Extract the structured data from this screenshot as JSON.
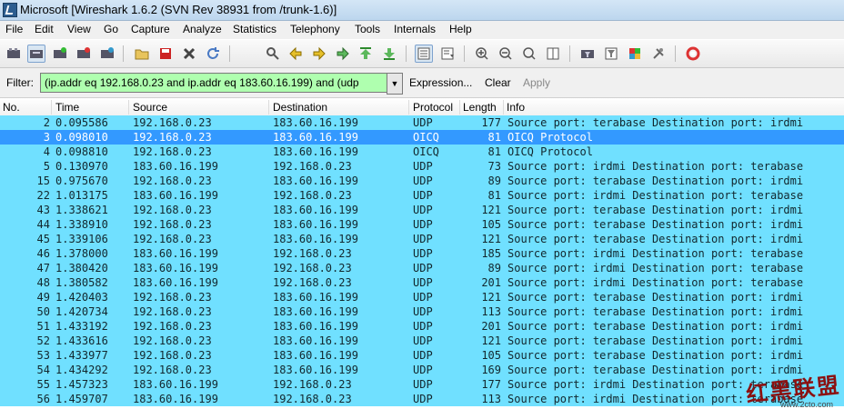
{
  "window": {
    "title": "Microsoft    [Wireshark 1.6.2  (SVN Rev 38931 from /trunk-1.6)]"
  },
  "menu": [
    "File",
    "Edit",
    "View",
    "Go",
    "Capture",
    "Analyze",
    "Statistics",
    "Telephony",
    "Tools",
    "Internals",
    "Help"
  ],
  "toolbar": {
    "icons": [
      "interface-list-icon",
      "capture-options-icon",
      "start-capture-icon",
      "stop-capture-icon",
      "restart-capture-icon",
      "open-file-icon",
      "save-file-icon",
      "close-file-icon",
      "reload-icon",
      "find-packet-icon",
      "go-back-icon",
      "go-forward-icon",
      "go-to-packet-icon",
      "go-first-icon",
      "go-last-icon",
      "colorize-icon",
      "autoscroll-icon",
      "zoom-in-icon",
      "zoom-out-icon",
      "zoom-normal-icon",
      "resize-columns-icon",
      "capture-filters-icon",
      "display-filters-icon",
      "coloring-rules-icon",
      "preferences-icon",
      "help-icon"
    ]
  },
  "filter": {
    "label": "Filter:",
    "value": "(ip.addr eq 192.168.0.23 and ip.addr eq 183.60.16.199) and (udp",
    "expression_label": "Expression...",
    "clear_label": "Clear",
    "apply_label": "Apply"
  },
  "columns": {
    "no": "No.",
    "time": "Time",
    "source": "Source",
    "destination": "Destination",
    "protocol": "Protocol",
    "length": "Length",
    "info": "Info"
  },
  "packets": [
    {
      "no": "2",
      "time": "0.095586",
      "src": "192.168.0.23",
      "dst": "183.60.16.199",
      "proto": "UDP",
      "len": "177",
      "info": "Source port: terabase  Destination port: irdmi"
    },
    {
      "no": "3",
      "time": "0.098010",
      "src": "192.168.0.23",
      "dst": "183.60.16.199",
      "proto": "OICQ",
      "len": "81",
      "info": "OICQ Protocol"
    },
    {
      "no": "4",
      "time": "0.098810",
      "src": "192.168.0.23",
      "dst": "183.60.16.199",
      "proto": "OICQ",
      "len": "81",
      "info": "OICQ Protocol"
    },
    {
      "no": "5",
      "time": "0.130970",
      "src": "183.60.16.199",
      "dst": "192.168.0.23",
      "proto": "UDP",
      "len": "73",
      "info": "Source port: irdmi  Destination port: terabase"
    },
    {
      "no": "15",
      "time": "0.975670",
      "src": "192.168.0.23",
      "dst": "183.60.16.199",
      "proto": "UDP",
      "len": "89",
      "info": "Source port: terabase  Destination port: irdmi"
    },
    {
      "no": "22",
      "time": "1.013175",
      "src": "183.60.16.199",
      "dst": "192.168.0.23",
      "proto": "UDP",
      "len": "81",
      "info": "Source port: irdmi  Destination port: terabase"
    },
    {
      "no": "43",
      "time": "1.338621",
      "src": "192.168.0.23",
      "dst": "183.60.16.199",
      "proto": "UDP",
      "len": "121",
      "info": "Source port: terabase  Destination port: irdmi"
    },
    {
      "no": "44",
      "time": "1.338910",
      "src": "192.168.0.23",
      "dst": "183.60.16.199",
      "proto": "UDP",
      "len": "105",
      "info": "Source port: terabase  Destination port: irdmi"
    },
    {
      "no": "45",
      "time": "1.339106",
      "src": "192.168.0.23",
      "dst": "183.60.16.199",
      "proto": "UDP",
      "len": "121",
      "info": "Source port: terabase  Destination port: irdmi"
    },
    {
      "no": "46",
      "time": "1.378000",
      "src": "183.60.16.199",
      "dst": "192.168.0.23",
      "proto": "UDP",
      "len": "185",
      "info": "Source port: irdmi  Destination port: terabase"
    },
    {
      "no": "47",
      "time": "1.380420",
      "src": "183.60.16.199",
      "dst": "192.168.0.23",
      "proto": "UDP",
      "len": "89",
      "info": "Source port: irdmi  Destination port: terabase"
    },
    {
      "no": "48",
      "time": "1.380582",
      "src": "183.60.16.199",
      "dst": "192.168.0.23",
      "proto": "UDP",
      "len": "201",
      "info": "Source port: irdmi  Destination port: terabase"
    },
    {
      "no": "49",
      "time": "1.420403",
      "src": "192.168.0.23",
      "dst": "183.60.16.199",
      "proto": "UDP",
      "len": "121",
      "info": "Source port: terabase  Destination port: irdmi"
    },
    {
      "no": "50",
      "time": "1.420734",
      "src": "192.168.0.23",
      "dst": "183.60.16.199",
      "proto": "UDP",
      "len": "113",
      "info": "Source port: terabase  Destination port: irdmi"
    },
    {
      "no": "51",
      "time": "1.433192",
      "src": "192.168.0.23",
      "dst": "183.60.16.199",
      "proto": "UDP",
      "len": "201",
      "info": "Source port: terabase  Destination port: irdmi"
    },
    {
      "no": "52",
      "time": "1.433616",
      "src": "192.168.0.23",
      "dst": "183.60.16.199",
      "proto": "UDP",
      "len": "121",
      "info": "Source port: terabase  Destination port: irdmi"
    },
    {
      "no": "53",
      "time": "1.433977",
      "src": "192.168.0.23",
      "dst": "183.60.16.199",
      "proto": "UDP",
      "len": "105",
      "info": "Source port: terabase  Destination port: irdmi"
    },
    {
      "no": "54",
      "time": "1.434292",
      "src": "192.168.0.23",
      "dst": "183.60.16.199",
      "proto": "UDP",
      "len": "169",
      "info": "Source port: terabase  Destination port: irdmi"
    },
    {
      "no": "55",
      "time": "1.457323",
      "src": "183.60.16.199",
      "dst": "192.168.0.23",
      "proto": "UDP",
      "len": "177",
      "info": "Source port: irdmi  Destination port: terabase"
    },
    {
      "no": "56",
      "time": "1.459707",
      "src": "183.60.16.199",
      "dst": "192.168.0.23",
      "proto": "UDP",
      "len": "113",
      "info": "Source port: irdmi  Destination port: terabase"
    }
  ],
  "selected_packet": "3",
  "colors": {
    "udp_row": "#70e0ff",
    "selected_row": "#3399ff",
    "filter_valid": "#afffaf"
  },
  "watermark": {
    "text": "红黑联盟",
    "sub": "www.2cto.com"
  }
}
